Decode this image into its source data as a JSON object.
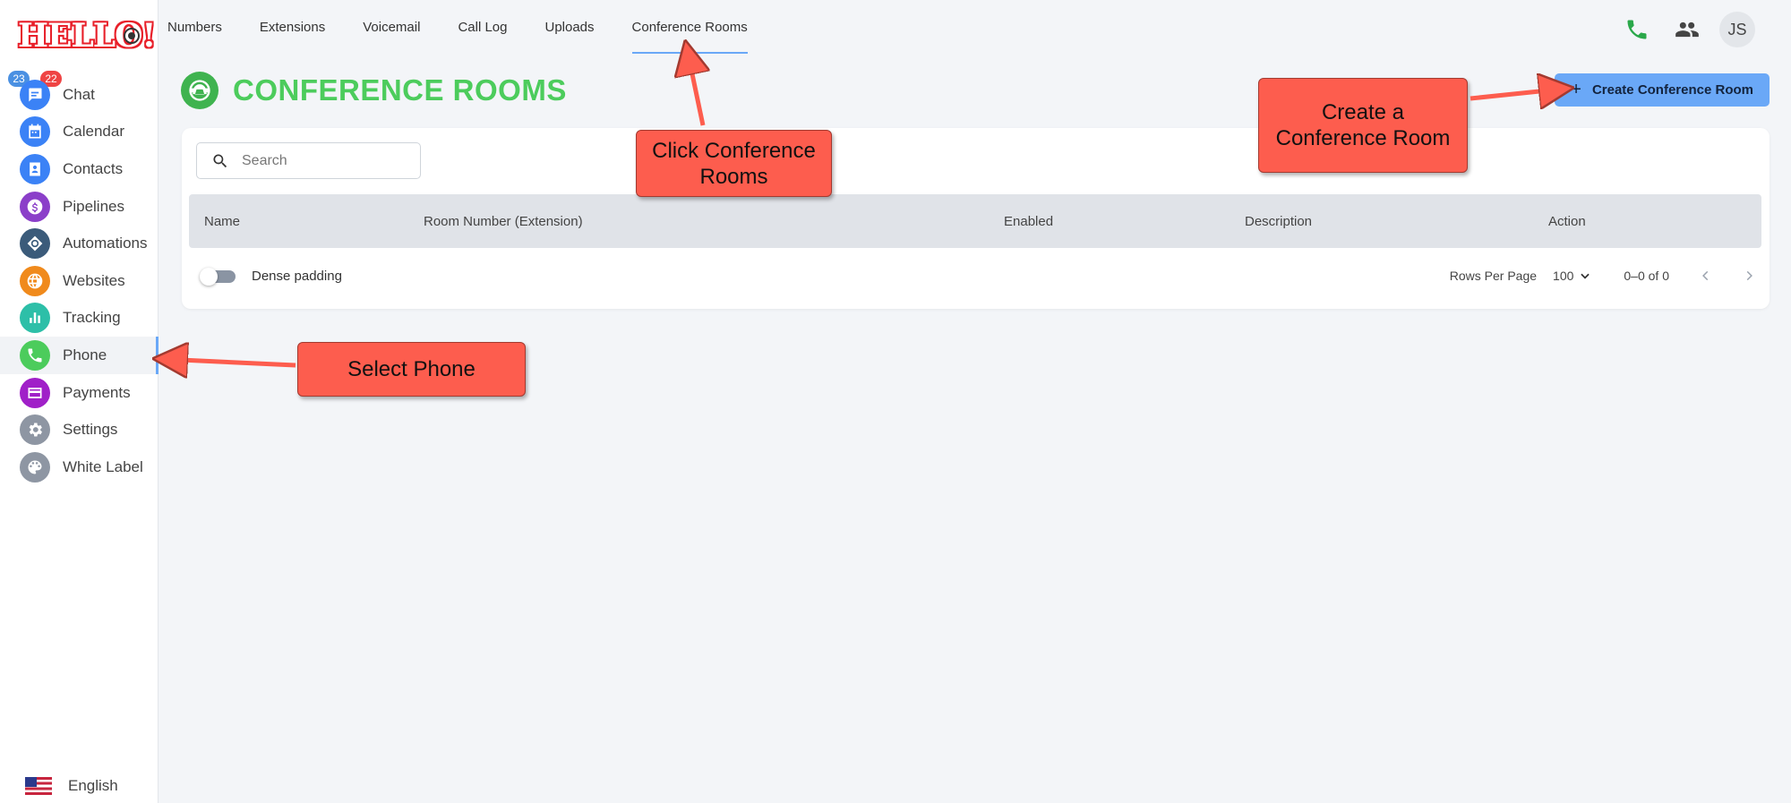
{
  "sidebar": {
    "logo_text": "HELLO!",
    "badges": {
      "blue": "23",
      "red": "22"
    },
    "items": [
      {
        "label": "Chat",
        "icon": "chat-icon",
        "color": "#3b82f6"
      },
      {
        "label": "Calendar",
        "icon": "calendar-icon",
        "color": "#3b82f6"
      },
      {
        "label": "Contacts",
        "icon": "contacts-icon",
        "color": "#3b82f6"
      },
      {
        "label": "Pipelines",
        "icon": "dollar-icon",
        "color": "#8b3fc9"
      },
      {
        "label": "Automations",
        "icon": "automation-icon",
        "color": "#3b5b7a"
      },
      {
        "label": "Websites",
        "icon": "globe-icon",
        "color": "#f08a1c"
      },
      {
        "label": "Tracking",
        "icon": "chart-icon",
        "color": "#2dbfa8"
      },
      {
        "label": "Phone",
        "icon": "phone-icon",
        "color": "#4ccc5c"
      },
      {
        "label": "Payments",
        "icon": "card-icon",
        "color": "#a020c8"
      },
      {
        "label": "Settings",
        "icon": "gear-icon",
        "color": "#8e96a3"
      },
      {
        "label": "White Label",
        "icon": "palette-icon",
        "color": "#8e96a3"
      }
    ],
    "active_index": 7,
    "language": "English"
  },
  "tabs": [
    "Numbers",
    "Extensions",
    "Voicemail",
    "Call Log",
    "Uploads",
    "Conference Rooms"
  ],
  "active_tab": 5,
  "header": {
    "avatar_initials": "JS",
    "title": "CONFERENCE ROOMS",
    "create_button": "Create Conference Room"
  },
  "table": {
    "search_placeholder": "Search",
    "columns": [
      "Name",
      "Room Number (Extension)",
      "Enabled",
      "Description",
      "Action"
    ],
    "dense_padding_label": "Dense padding",
    "rows_per_page_label": "Rows Per Page",
    "rows_per_page_value": "100",
    "range_label": "0–0 of 0"
  },
  "callouts": {
    "conference": "Click Conference\nRooms",
    "create": "Create a\nConference Room",
    "phone": "Select Phone"
  },
  "colors": {
    "accent": "#6aa8f7",
    "title_green": "#4ccc5c",
    "callout": "#fd5d4e"
  }
}
